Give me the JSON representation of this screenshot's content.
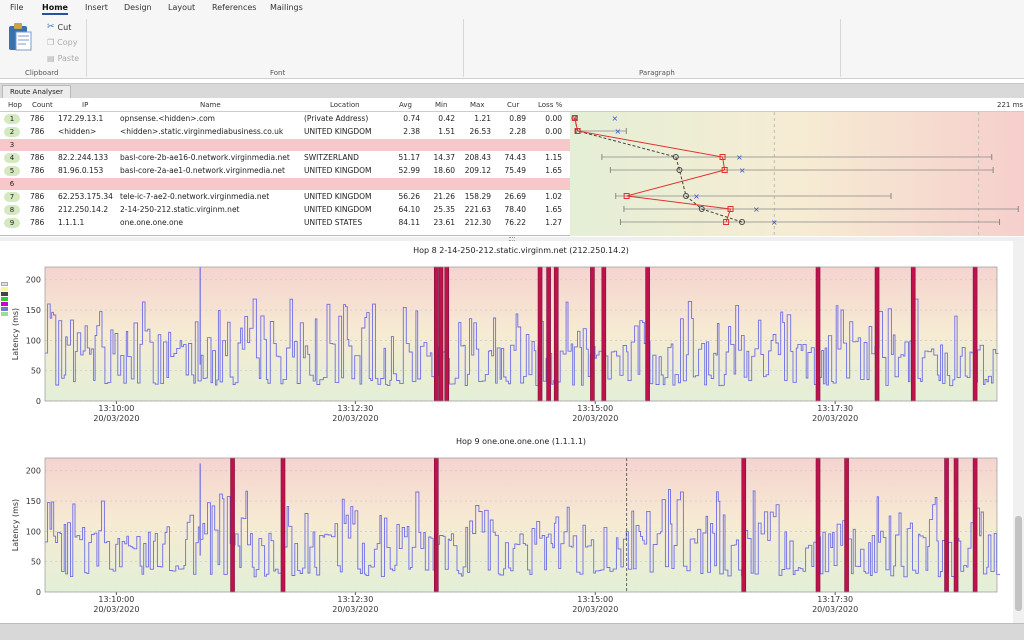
{
  "menu": [
    "File",
    "Home",
    "Insert",
    "Design",
    "Layout",
    "References",
    "Mailings"
  ],
  "ribbon": {
    "clipboard_label": "Clipboard",
    "font_label": "Font",
    "paragraph_label": "Paragraph",
    "cut": "Cut",
    "copy": "Copy",
    "paste": "Paste"
  },
  "tab_label": "Route Analyser",
  "grid": {
    "headers": [
      "Hop",
      "Count",
      "IP",
      "Name",
      "Location",
      "Avg",
      "Min",
      "Max",
      "Cur",
      "Loss %"
    ],
    "max_label": "221 ms",
    "rows": [
      {
        "hop": "1",
        "count": "786",
        "ip": "172.29.13.1",
        "name": "opnsense.<hidden>.com",
        "location": "(Private Address)",
        "avg": "0.74",
        "min": "0.42",
        "max": "1.21",
        "cur": "0.89",
        "loss": "0.00"
      },
      {
        "hop": "2",
        "count": "786",
        "ip": "<hidden>",
        "name": "<hidden>.static.virginmediabusiness.co.uk",
        "location": "UNITED KINGDOM",
        "avg": "2.38",
        "min": "1.51",
        "max": "26.53",
        "cur": "2.28",
        "loss": "0.00"
      },
      {
        "hop": "3",
        "count": "",
        "ip": "",
        "name": "",
        "location": "",
        "avg": "",
        "min": "",
        "max": "",
        "cur": "",
        "loss": ""
      },
      {
        "hop": "4",
        "count": "786",
        "ip": "82.2.244.133",
        "name": "basl-core-2b-ae16-0.network.virginmedia.net",
        "location": "SWITZERLAND",
        "avg": "51.17",
        "min": "14.37",
        "max": "208.43",
        "cur": "74.43",
        "loss": "1.15"
      },
      {
        "hop": "5",
        "count": "786",
        "ip": "81.96.0.153",
        "name": "basl-core-2a-ae1-0.network.virginmedia.net",
        "location": "UNITED KINGDOM",
        "avg": "52.99",
        "min": "18.60",
        "max": "209.12",
        "cur": "75.49",
        "loss": "1.65"
      },
      {
        "hop": "6",
        "count": "",
        "ip": "",
        "name": "",
        "location": "",
        "avg": "",
        "min": "",
        "max": "",
        "cur": "",
        "loss": ""
      },
      {
        "hop": "7",
        "count": "786",
        "ip": "62.253.175.34",
        "name": "tele-ic-7-ae2-0.network.virginmedia.net",
        "location": "UNITED KINGDOM",
        "avg": "56.26",
        "min": "21.26",
        "max": "158.29",
        "cur": "26.69",
        "loss": "1.02"
      },
      {
        "hop": "8",
        "count": "786",
        "ip": "212.250.14.2",
        "name": "2-14-250-212.static.virginm.net",
        "location": "UNITED KINGDOM",
        "avg": "64.10",
        "min": "25.35",
        "max": "221.63",
        "cur": "78.40",
        "loss": "1.65"
      },
      {
        "hop": "9",
        "count": "786",
        "ip": "1.1.1.1",
        "name": "one.one.one.one",
        "location": "UNITED STATES",
        "avg": "84.11",
        "min": "23.61",
        "max": "212.30",
        "cur": "76.22",
        "loss": "1.27"
      }
    ]
  },
  "chart_data": [
    {
      "type": "line",
      "title": "Hop 8 2-14-250-212.static.virginm.net (212.250.14.2)",
      "ylabel": "Latency (ms)",
      "ylim": [
        0,
        221
      ],
      "yticks": [
        0,
        50,
        100,
        150,
        200
      ],
      "xticks": [
        {
          "time": "13:10:00",
          "date": "20/03/2020"
        },
        {
          "time": "13:12:30",
          "date": "20/03/2020"
        },
        {
          "time": "13:15:00",
          "date": "20/03/2020"
        },
        {
          "time": "13:17:30",
          "date": "20/03/2020"
        }
      ],
      "series": [
        {
          "color": "#6e6ee8",
          "seed": 7,
          "spikes": [
            [
              0.163,
              221
            ]
          ]
        }
      ],
      "loss_events": [
        0.411,
        0.416,
        0.422,
        0.52,
        0.529,
        0.537,
        0.575,
        0.587,
        0.633,
        0.812,
        0.874,
        0.912,
        0.977
      ]
    },
    {
      "type": "line",
      "title": "Hop 9 one.one.one.one (1.1.1.1)",
      "ylabel": "Latency (ms)",
      "ylim": [
        0,
        212
      ],
      "yticks": [
        0,
        50,
        100,
        150,
        200
      ],
      "xticks": [
        {
          "time": "13:10:00",
          "date": "20/03/2020"
        },
        {
          "time": "13:12:30",
          "date": "20/03/2020"
        },
        {
          "time": "13:15:00",
          "date": "20/03/2020"
        },
        {
          "time": "13:17:30",
          "date": "20/03/2020"
        }
      ],
      "series": [
        {
          "color": "#6e6ee8",
          "seed": 13,
          "spikes": [
            [
              0.163,
              212
            ]
          ]
        }
      ],
      "loss_events": [
        0.197,
        0.25,
        0.411,
        0.734,
        0.812,
        0.842,
        0.947,
        0.957,
        0.977
      ],
      "cursor": 0.611
    }
  ],
  "route_graph": {
    "avg_points": [
      0.74,
      2.38,
      null,
      51.17,
      52.99,
      null,
      56.26,
      64.1,
      84.11
    ],
    "cur_points": [
      0.89,
      2.28,
      null,
      74.43,
      75.49,
      null,
      26.69,
      78.4,
      76.22
    ],
    "min_points": [
      0.42,
      1.51,
      null,
      14.37,
      18.6,
      null,
      21.26,
      25.35,
      23.61
    ],
    "max_points": [
      1.21,
      26.53,
      null,
      208.43,
      209.12,
      null,
      158.29,
      221.63,
      212.3
    ],
    "scale_max": 221
  }
}
